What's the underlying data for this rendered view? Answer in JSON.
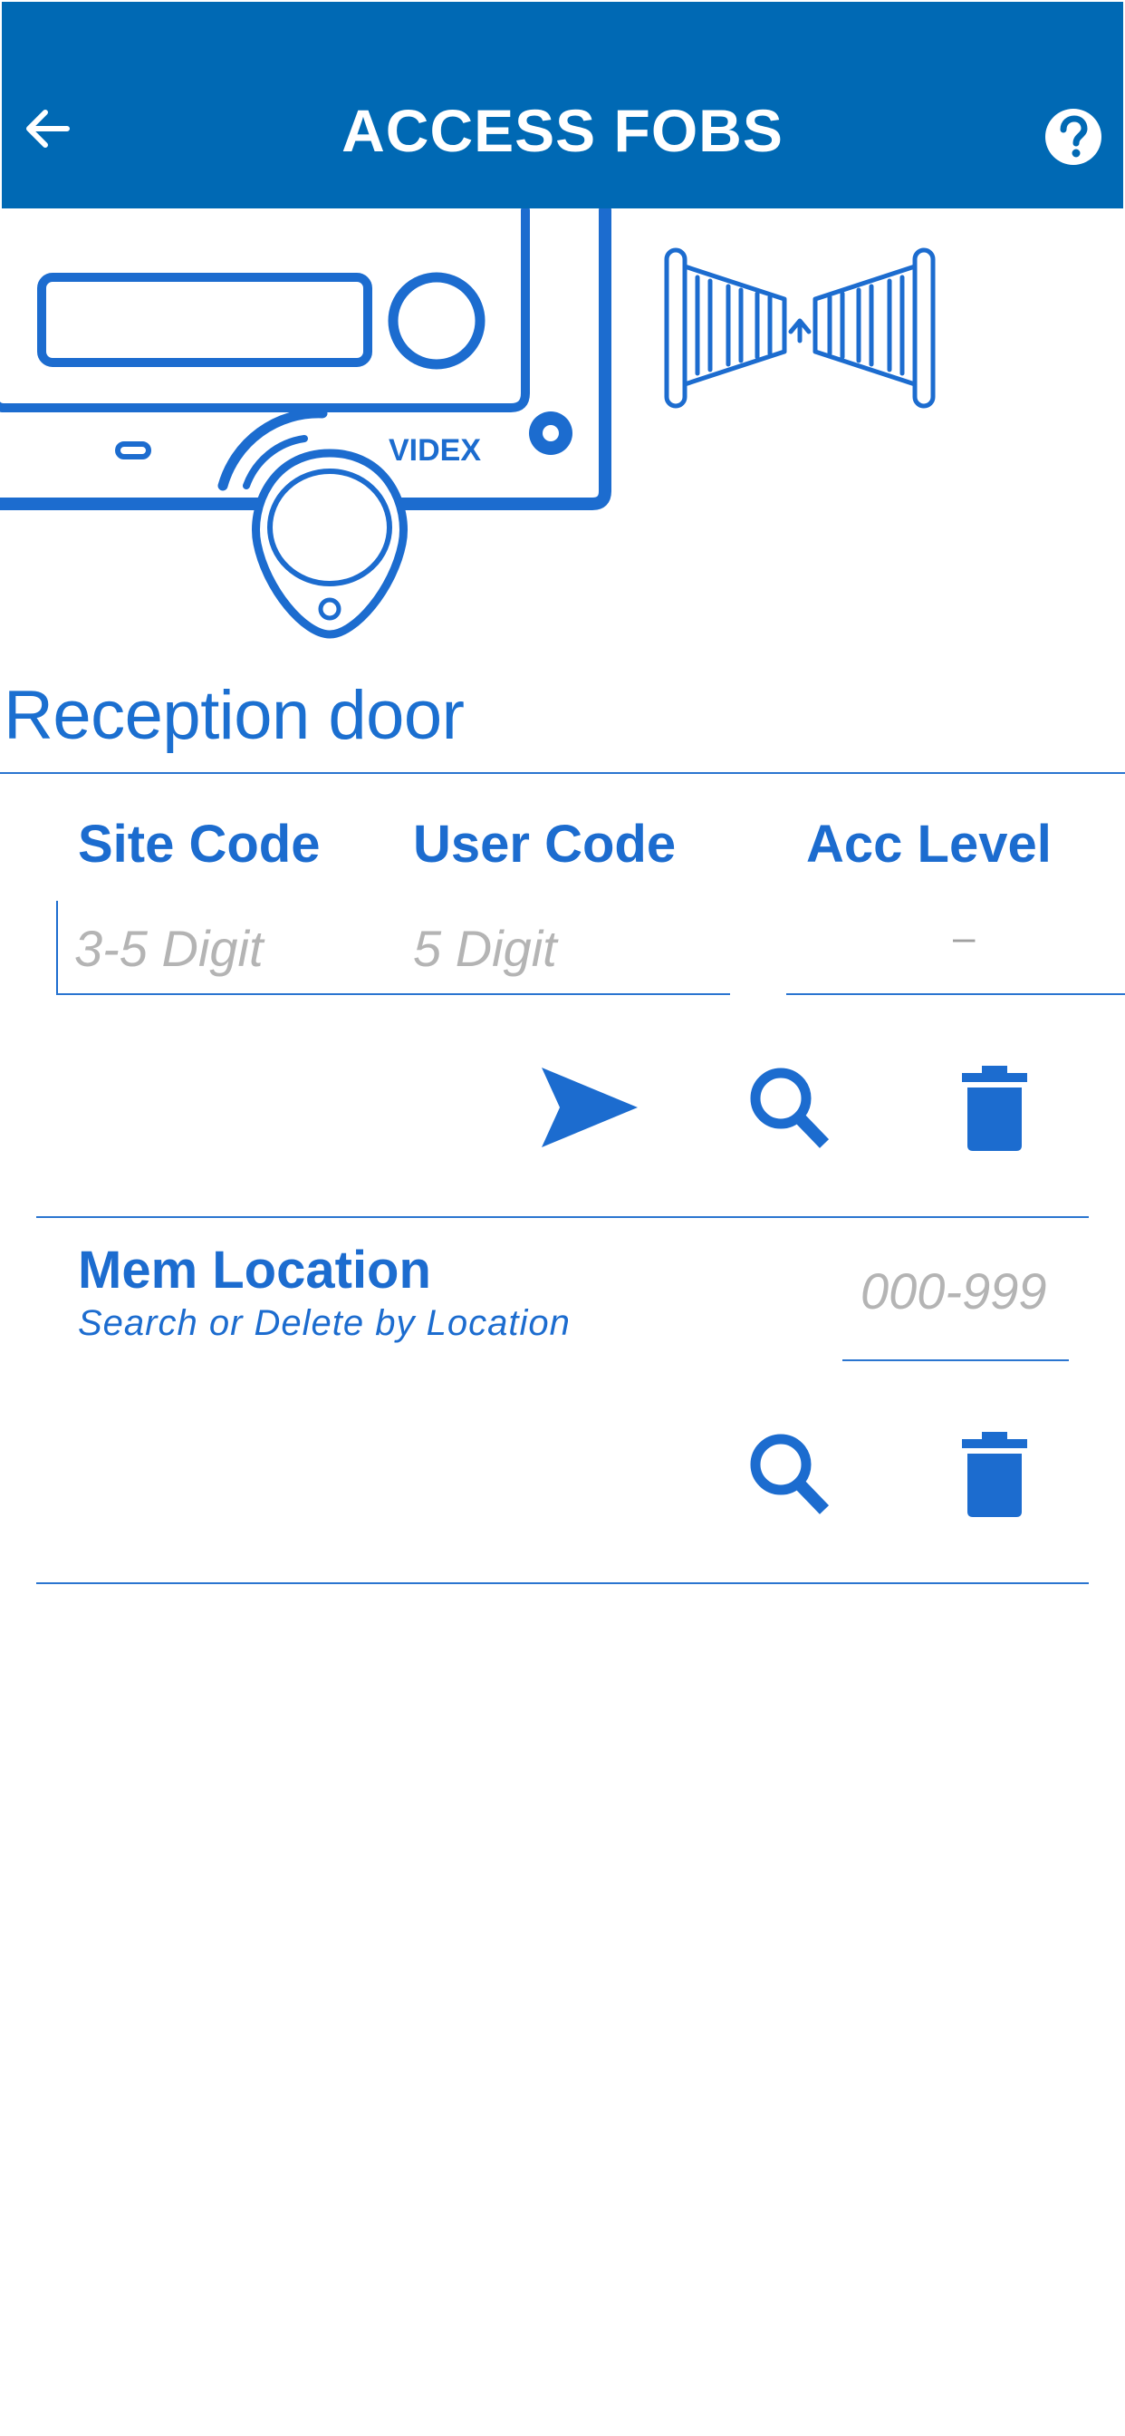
{
  "header": {
    "title": "ACCESS FOBS",
    "back_icon": "arrow-left-icon",
    "help_icon": "help-circle-icon",
    "background_color": "#0069b4"
  },
  "illustration": {
    "panel_brand": "VIDEX"
  },
  "door": {
    "name": "Reception door"
  },
  "fob_form": {
    "site_code_label": "Site Code",
    "user_code_label": "User Code",
    "acc_level_label": "Acc Level",
    "site_code_placeholder": "3-5 Digit",
    "user_code_placeholder": "5 Digit",
    "acc_level_value": "–"
  },
  "actions": {
    "send_icon": "send-icon",
    "search_icon": "search-icon",
    "delete_icon": "trash-icon"
  },
  "mem_location": {
    "title": "Mem Location",
    "subtitle": "Search or Delete by Location",
    "placeholder": "000-999"
  },
  "colors": {
    "accent": "#1c6ccf",
    "header": "#0069b4",
    "placeholder": "#b4b4b4"
  }
}
